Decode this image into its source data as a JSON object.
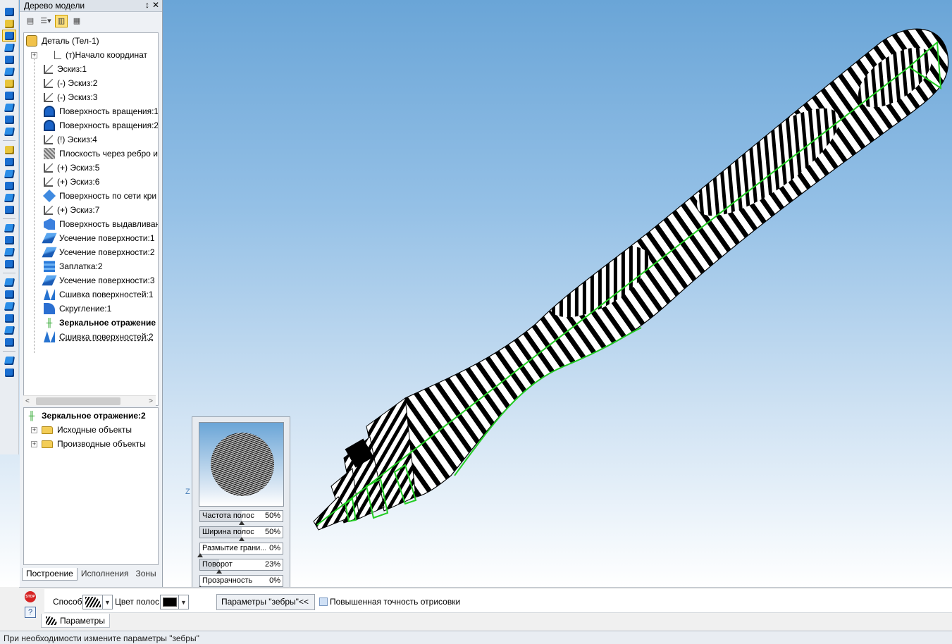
{
  "tree_panel": {
    "title": "Дерево модели",
    "pin": "↕",
    "close": "✕",
    "root": "Деталь (Тел-1)",
    "items": [
      {
        "label": "(т)Начало координат",
        "icon": "origin-icon",
        "expandable": true
      },
      {
        "label": "Эскиз:1",
        "icon": "sketch-icon"
      },
      {
        "label": "(-) Эскиз:2",
        "icon": "sketch-icon"
      },
      {
        "label": "(-) Эскиз:3",
        "icon": "sketch-icon"
      },
      {
        "label": "Поверхность вращения:1",
        "icon": "revolve-surface-icon"
      },
      {
        "label": "Поверхность вращения:2",
        "icon": "revolve-surface-icon"
      },
      {
        "label": "(!) Эскиз:4",
        "icon": "sketch-icon"
      },
      {
        "label": "Плоскость через ребро и",
        "icon": "plane-icon"
      },
      {
        "label": "(+) Эскиз:5",
        "icon": "sketch-icon"
      },
      {
        "label": "(+) Эскиз:6",
        "icon": "sketch-icon"
      },
      {
        "label": "Поверхность по сети кри",
        "icon": "network-surface-icon"
      },
      {
        "label": "(+) Эскиз:7",
        "icon": "sketch-icon"
      },
      {
        "label": "Поверхность выдавливан",
        "icon": "extrude-surface-icon"
      },
      {
        "label": "Усечение поверхности:1",
        "icon": "trim-surface-icon"
      },
      {
        "label": "Усечение поверхности:2",
        "icon": "trim-surface-icon"
      },
      {
        "label": "Заплатка:2",
        "icon": "patch-icon"
      },
      {
        "label": "Усечение поверхности:3",
        "icon": "trim-surface-icon"
      },
      {
        "label": "Сшивка поверхностей:1",
        "icon": "sew-surfaces-icon"
      },
      {
        "label": "Скругление:1",
        "icon": "fillet-icon"
      },
      {
        "label": "Зеркальное отражение",
        "icon": "mirror-icon",
        "bold": true
      },
      {
        "label": "Сшивка поверхностей:2",
        "icon": "sew-surfaces-icon"
      }
    ],
    "bottom_title": "Зеркальное отражение:2",
    "bottom_items": [
      "Исходные объекты",
      "Производные объекты"
    ],
    "tabs": [
      "Построение",
      "Исполнения",
      "Зоны"
    ]
  },
  "zebra": {
    "sliders": [
      {
        "label": "Частота полос",
        "value": "50%",
        "fraction": 0.5
      },
      {
        "label": "Ширина полос",
        "value": "50%",
        "fraction": 0.5
      },
      {
        "label": "Размытие грани...",
        "value": "0%",
        "fraction": 0.0
      },
      {
        "label": "Поворот",
        "value": "23%",
        "fraction": 0.23
      },
      {
        "label": "Прозрачность",
        "value": "0%",
        "fraction": 0.0
      }
    ]
  },
  "properties": {
    "method_label": "Способ",
    "stripe_color_label": "Цвет полос",
    "stripe_color": "#000000",
    "zebra_params_label": "Параметры \"зебры\"",
    "collapse": "<<",
    "precision_label": "Повышенная точность отрисовки",
    "params_tab": "Параметры",
    "stop": "STOP",
    "help": "?"
  },
  "viewport": {
    "axis_label": "Z",
    "highlight_color": "#22cc22"
  },
  "status": {
    "text": "При необходимости измените параметры \"зебры\""
  }
}
